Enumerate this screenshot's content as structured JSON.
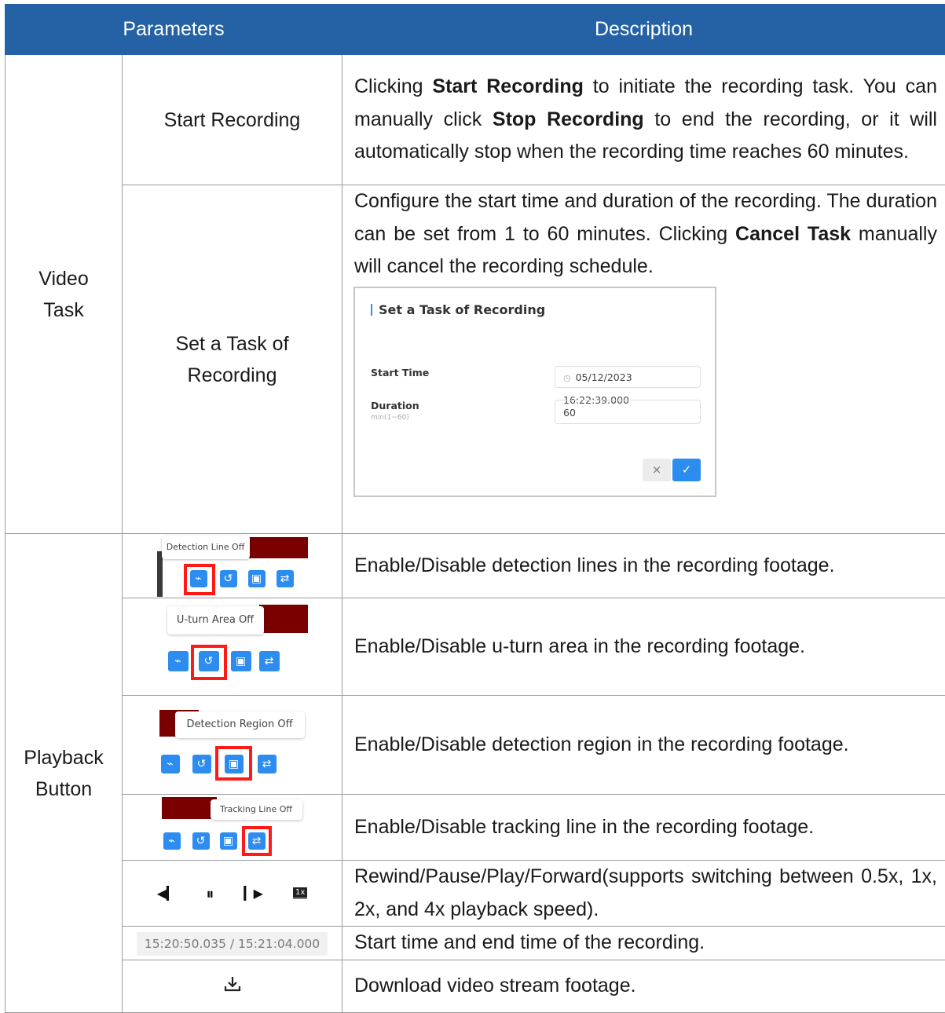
{
  "header": {
    "col_params": "Parameters",
    "col_desc": "Description"
  },
  "video_task": {
    "group_line1": "Video",
    "group_line2": "Task",
    "start_recording": {
      "param": "Start Recording",
      "desc_1": "Clicking ",
      "desc_b1": "Start Recording",
      "desc_2": " to initiate the recording task. You can manually click ",
      "desc_b2": "Stop Recording",
      "desc_3": " to end the recording, or it will automatically stop when the recording time reaches 60 minutes."
    },
    "set_task": {
      "param_line1": "Set a Task of",
      "param_line2": "Recording",
      "desc_1": "Configure the start time and duration of the recording. The duration can be set from 1 to 60 minutes. Clicking ",
      "desc_b1": "Cancel Task",
      "desc_2": " manually will cancel the recording schedule.",
      "dialog": {
        "title": "Set a Task of Recording",
        "start_time_label": "Start Time",
        "start_time_value": "05/12/2023 16:22:39.000",
        "duration_label": "Duration",
        "duration_hint": "min(1~60)",
        "duration_value": "60",
        "cancel_glyph": "×",
        "ok_glyph": "✓"
      }
    }
  },
  "playback": {
    "group_line1": "Playback",
    "group_line2": "Button",
    "rows": [
      {
        "tooltip": "Detection Line Off",
        "desc": "Enable/Disable detection lines in the recording footage."
      },
      {
        "tooltip": "U-turn Area Off",
        "desc": "Enable/Disable u-turn area in the recording footage."
      },
      {
        "tooltip": "Detection Region Off",
        "desc": "Enable/Disable detection region in the recording footage."
      },
      {
        "tooltip": "Tracking Line Off",
        "desc": "Enable/Disable tracking line in the recording footage."
      }
    ],
    "controls": {
      "speed_label": "1x",
      "desc": "Rewind/Pause/Play/Forward(supports switching between 0.5x, 1x, 2x, and 4x playback speed)."
    },
    "time": {
      "value": "15:20:50.035 / 15:21:04.000",
      "desc": "Start time and end time of the recording."
    },
    "download": {
      "desc": "Download video stream footage."
    }
  },
  "colors": {
    "header_bg": "#2462a5",
    "icon_blue": "#2d8cf0",
    "highlight_red": "#ff1a1a",
    "dark_red": "#7a0000"
  }
}
